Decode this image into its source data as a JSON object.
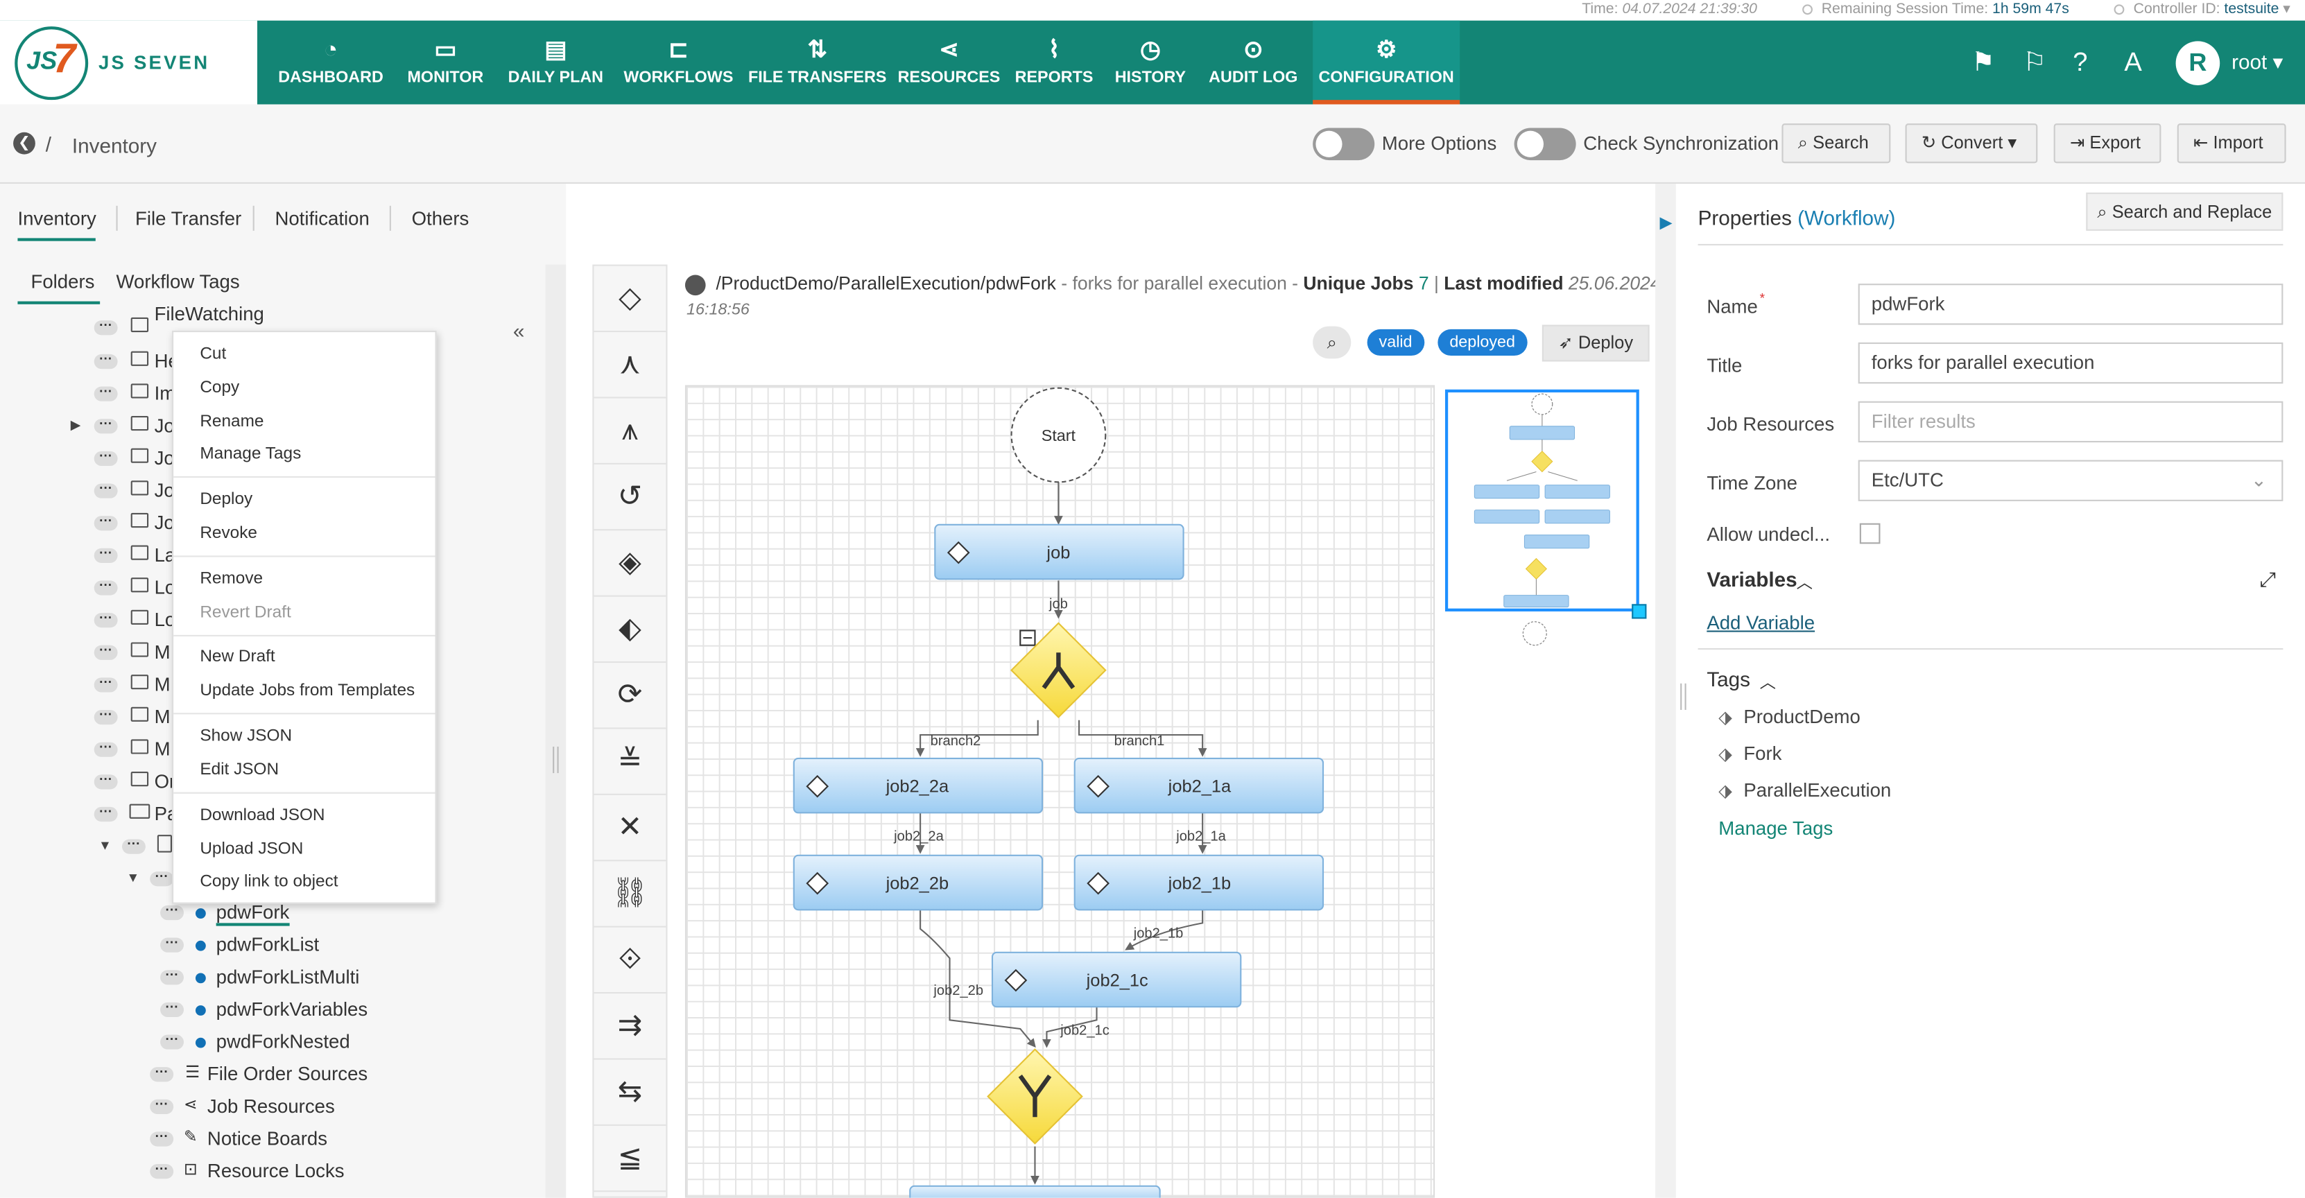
{
  "status_bar": {
    "time_label": "Time:",
    "time_value": "04.07.2024 21:39:30",
    "session_label": "Remaining Session Time:",
    "session_value": "1h 59m 47s",
    "controller_label": "Controller ID:",
    "controller_value": "testsuite"
  },
  "brand": {
    "name": "JS SEVEN",
    "colors": {
      "primary": "#138575",
      "accent": "#e05a1f",
      "link": "#1a7fb2"
    }
  },
  "nav": [
    {
      "label": "DASHBOARD",
      "icon": "dashboard-icon"
    },
    {
      "label": "MONITOR",
      "icon": "monitor-icon"
    },
    {
      "label": "DAILY PLAN",
      "icon": "calendar-icon"
    },
    {
      "label": "WORKFLOWS",
      "icon": "workflow-icon"
    },
    {
      "label": "FILE TRANSFERS",
      "icon": "transfer-icon"
    },
    {
      "label": "RESOURCES",
      "icon": "share-icon"
    },
    {
      "label": "REPORTS",
      "icon": "chart-icon"
    },
    {
      "label": "HISTORY",
      "icon": "clock-icon"
    },
    {
      "label": "AUDIT LOG",
      "icon": "audit-icon"
    },
    {
      "label": "CONFIGURATION",
      "icon": "gear-icon",
      "active": true
    }
  ],
  "user": {
    "initial": "R",
    "name": "root"
  },
  "toolbar": {
    "breadcrumb": "Inventory",
    "more_options": "More Options",
    "check_sync": "Check Synchronization",
    "search": "Search",
    "convert": "Convert",
    "export": "Export",
    "import": "Import"
  },
  "left_tabs": [
    "Inventory",
    "File Transfer",
    "Notification",
    "Others"
  ],
  "sub_tabs": [
    "Folders",
    "Workflow Tags"
  ],
  "tree": {
    "folders": [
      "FileWatching",
      "He",
      "Im",
      "Jo",
      "Jo",
      "Jo",
      "Jo",
      "La",
      "Lo",
      "Lo",
      "M",
      "M",
      "M",
      "M",
      "Or",
      "Pa"
    ],
    "workflows": [
      "pdwFork",
      "pdwForkList",
      "pdwForkListMulti",
      "pdwForkVariables",
      "pwdForkNested"
    ],
    "groups": [
      "File Order Sources",
      "Job Resources",
      "Notice Boards",
      "Resource Locks"
    ]
  },
  "context_menu": {
    "group1": [
      "Cut",
      "Copy",
      "Rename",
      "Manage Tags"
    ],
    "group2": [
      "Deploy",
      "Revoke"
    ],
    "group3": [
      "Remove",
      "Revert Draft"
    ],
    "group4": [
      "New Draft",
      "Update Jobs from Templates"
    ],
    "group5": [
      "Show JSON",
      "Edit JSON"
    ],
    "group6": [
      "Download JSON",
      "Upload JSON",
      "Copy link to object"
    ]
  },
  "editor": {
    "path": "/ProductDemo/ParallelExecution/pdwFork",
    "description": "- forks for parallel execution -",
    "unique_jobs_label": "Unique Jobs",
    "unique_jobs": "7",
    "last_modified_label": "Last modified",
    "last_modified_date": "25.06.2024",
    "last_modified_time": "16:18:56",
    "badge_valid": "valid",
    "badge_deployed": "deployed",
    "deploy": "Deploy"
  },
  "workflow": {
    "start": "Start",
    "job": "job",
    "edge_job": "job",
    "branch2": "branch2",
    "branch1": "branch1",
    "job2_2a": "job2_2a",
    "job2_1a": "job2_1a",
    "job2_2b": "job2_2b",
    "job2_1b": "job2_1b",
    "job2_1c": "job2_1c"
  },
  "properties": {
    "title": "Properties",
    "title_type": "(Workflow)",
    "search_replace": "Search and Replace",
    "name_label": "Name",
    "name_value": "pdwFork",
    "title_label": "Title",
    "title_value": "forks for parallel execution",
    "job_resources_label": "Job Resources",
    "job_resources_placeholder": "Filter results",
    "timezone_label": "Time Zone",
    "timezone_value": "Etc/UTC",
    "allow_label": "Allow undecl...",
    "variables": "Variables",
    "add_variable": "Add Variable",
    "tags": "Tags",
    "tag_list": [
      "ProductDemo",
      "Fork",
      "ParallelExecution"
    ],
    "manage_tags": "Manage Tags"
  }
}
